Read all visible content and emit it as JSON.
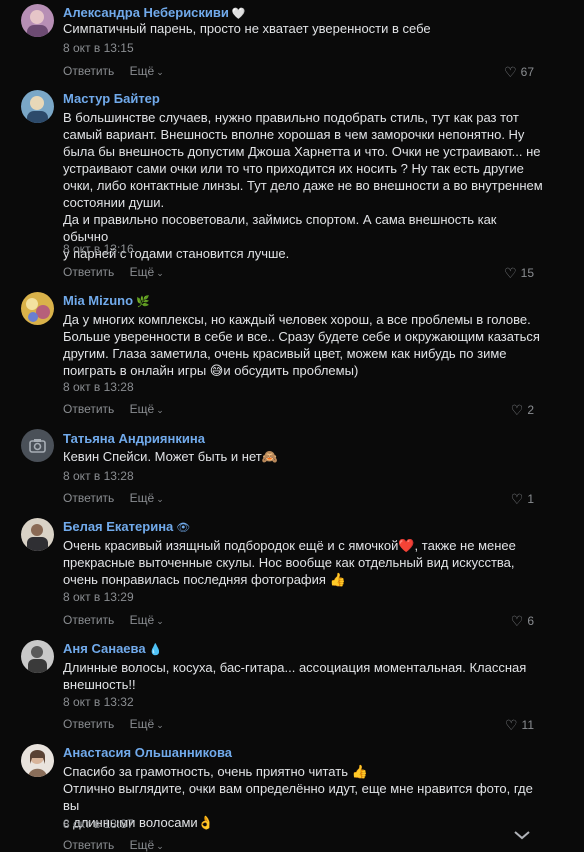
{
  "comments": [
    {
      "author": "Александра Неберискиви",
      "badge": "🤍",
      "lines": [
        "Симпатичный парень, просто не хватает уверенности в себе"
      ],
      "date": "8 окт в 13:15",
      "likes": "67",
      "reply": "Ответить",
      "more": "Ещё"
    },
    {
      "author": "Мастур Байтер",
      "badge": "",
      "lines": [
        "В большинстве случаев, нужно правильно подобрать стиль, тут как раз тот",
        "самый вариант. Внешность вполне хорошая в чем заморочки непонятно. Ну",
        "была бы внешность допустим Джоша Харнетта и что. Очки не устраивают... не",
        "устраивают сами очки или то что приходится их носить ? Ну так есть другие",
        "очки, либо контактные линзы. Тут дело даже не во внешности а во внутреннем",
        "состоянии души.",
        "Да и правильно посоветовали, займись спортом. А сама внешность как обычно",
        "у парней с годами становится лучше."
      ],
      "date": "8 окт в 13:16",
      "likes": "15",
      "reply": "Ответить",
      "more": "Ещё"
    },
    {
      "author": "Mia Mizuno",
      "badge": "🌿",
      "lines": [
        "Да у многих комплексы, но каждый человек хорош, а все проблемы в голове.",
        "Больше уверенности в себе и все.. Сразу будете себе и окружающим казаться",
        "другим. Глаза заметила, очень красивый цвет, можем как нибудь по зиме",
        "поиграть в онлайн игры 😅и обсудить проблемы)"
      ],
      "date": "8 окт в 13:28",
      "likes": "2",
      "reply": "Ответить",
      "more": "Ещё"
    },
    {
      "author": "Татьяна Андриянкина",
      "badge": "",
      "lines": [
        "Кевин Спейси. Может быть и нет🙈"
      ],
      "date": "8 окт в 13:28",
      "likes": "1",
      "reply": "Ответить",
      "more": "Ещё"
    },
    {
      "author": "Белая Екатерина",
      "badge": "👁",
      "lines": [
        "Очень красивый изящный подбородок ещё и с ямочкой❤️, также не менее",
        "прекрасные выточенные скулы. Нос вообще как отдельный вид искусства,",
        "очень понравилась последняя фотография 👍"
      ],
      "date": "8 окт в 13:29",
      "likes": "6",
      "reply": "Ответить",
      "more": "Ещё"
    },
    {
      "author": "Аня Санаева",
      "badge": "💧",
      "lines": [
        "Длинные волосы, косуха, бас-гитара... ассоциация моментальная. Классная",
        "внешность!!"
      ],
      "date": "8 окт в 13:32",
      "likes": "11",
      "reply": "Ответить",
      "more": "Ещё"
    },
    {
      "author": "Анастасия Ольшанникова",
      "badge": "",
      "lines": [
        "Спасибо за грамотность, очень приятно читать 👍",
        "Отлично выглядите, очки вам определённо идут, еще мне нравится фото, где вы",
        "с длинными волосами👌"
      ],
      "date": "8 окт в 13:37",
      "likes": "",
      "reply": "Ответить",
      "more": "Ещё"
    }
  ],
  "colors": {
    "background": "#0a0a0a",
    "author": "#71aaeb",
    "text": "#e1e3e6",
    "meta": "#8a8d91"
  },
  "icons": {
    "like": "heart-icon",
    "more": "chevron-down-icon",
    "scroll": "chevron-down-icon"
  }
}
